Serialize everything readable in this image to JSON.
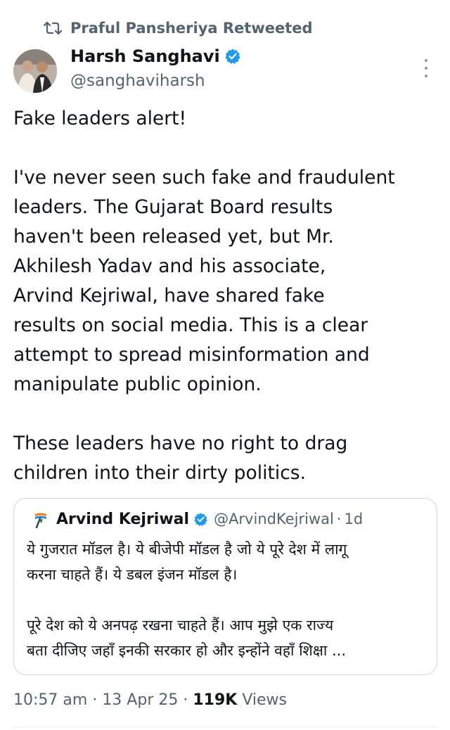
{
  "retweet": {
    "label": "Praful Pansheriya Retweeted",
    "icon": "retweet-icon"
  },
  "author": {
    "name": "Harsh Sanghavi",
    "handle": "@sanghaviharsh",
    "verified": true,
    "verified_color": "#1d9bf0"
  },
  "tweet": {
    "paragraphs": [
      "Fake leaders alert!",
      "I've never seen such fake and fraudulent\nleaders. The Gujarat Board results\nhaven't been released yet, but Mr.\nAkhilesh Yadav and his associate,\nArvind Kejriwal, have shared fake\nresults on social media. This is a clear\nattempt to spread misinformation and\nmanipulate public opinion.",
      "These leaders have no right to drag\nchildren into their dirty politics."
    ]
  },
  "quote": {
    "name": "Arvind Kejriwal",
    "handle": "@ArvindKejriwal",
    "separator": "·",
    "time": "1d",
    "verified": true,
    "paragraphs": [
      "ये गुजरात मॉडल है। ये बीजेपी मॉडल है जो ये पूरे देश में लागू\nकरना चाहते हैं। ये डबल इंजन मॉडल है।",
      "पूरे देश को ये अनपढ़ रखना चाहते हैं। आप मुझे एक राज्य\nबता दीजिए जहाँ इनकी सरकार हो और इन्होंने वहाँ शिक्षा ..."
    ]
  },
  "meta": {
    "time": "10:57 am",
    "date": "13 Apr 25",
    "views_count": "119K",
    "views_label": "Views",
    "separator": "·"
  },
  "colors": {
    "text": "#0f1419",
    "secondary": "#536471",
    "border": "#cfd9de",
    "verified": "#1d9bf0"
  }
}
